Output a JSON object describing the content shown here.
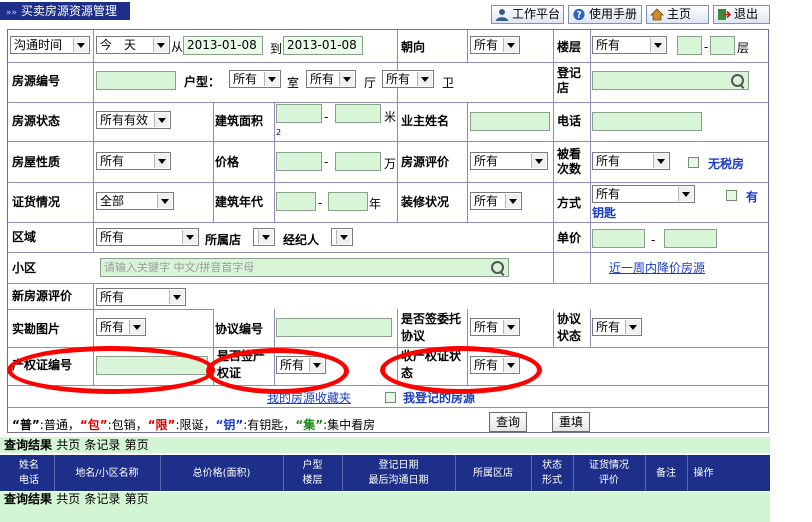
{
  "header": {
    "title": "买卖房源资源管理",
    "nav": {
      "workbench": "工作平台",
      "manual": "使用手册",
      "home": "主页",
      "logout": "退出"
    }
  },
  "form": {
    "row1": {
      "time_type": "沟通时间",
      "today": "今　天",
      "from_label": "从",
      "date_from": "2013-01-08",
      "to_label": "到",
      "date_to": "2013-01-08",
      "orientation_label": "朝向",
      "orientation_value": "所有",
      "floor_label": "楼层",
      "floor_value": "所有",
      "floor_sep": "-",
      "floor_unit": "层"
    },
    "row2": {
      "code_label": "房源编号",
      "layout_label": "户型：",
      "room_value": "所有",
      "room_unit": "室",
      "hall_value": "所有",
      "hall_unit": "厅",
      "bath_value": "所有",
      "bath_unit": "卫",
      "reg_store_label": "登记店"
    },
    "row3": {
      "status_label": "房源状态",
      "status_value": "所有有效",
      "area_label": "建筑面积",
      "area_sep": "-",
      "area_unit": "米",
      "area_sup": "2",
      "owner_label": "业主姓名",
      "phone_label": "电话"
    },
    "row4": {
      "nature_label": "房屋性质",
      "nature_value": "所有",
      "price_label": "价格",
      "price_sep": "-",
      "price_unit": "万",
      "eval_label": "房源评价",
      "eval_value": "所有",
      "viewed_label": "被看次数",
      "viewed_value": "所有",
      "no_tax": "无税房"
    },
    "row5": {
      "cert_label": "证货情况",
      "cert_value": "全部",
      "year_label": "建筑年代",
      "year_sep": "-",
      "year_unit": "年",
      "decor_label": "装修状况",
      "decor_value": "所有",
      "method_label": "方式",
      "method_value": "所有",
      "has_key_1": "有",
      "has_key_2": "钥匙"
    },
    "row6": {
      "district_label": "区域",
      "district_value": "所有",
      "store_label": "所属店",
      "agent_label": "经纪人",
      "unit_price_label": "单价",
      "unit_price_sep": "-"
    },
    "row7": {
      "community_label": "小区",
      "community_placeholder": "请输入关键字 中文/拼音首字母",
      "price_drop_link": "近一周内降价房源"
    },
    "row8": {
      "new_eval_label": "新房源评价",
      "new_eval_value": "所有"
    },
    "row9": {
      "photo_label": "实勘图片",
      "photo_value": "所有",
      "agreement_no_label": "协议编号",
      "signed_label_1": "是否签委托",
      "signed_label_2": "协议",
      "signed_value": "所有",
      "agreement_status_label_1": "协议",
      "agreement_status_label_2": "状态",
      "agreement_status_value": "所有"
    },
    "row10": {
      "prop_cert_no_label": "产权证编号",
      "has_cert_label_1": "是否签产",
      "has_cert_label_2": "权证",
      "has_cert_value": "所有",
      "receive_cert_label_1": "收产权证状",
      "receive_cert_label_2": "态",
      "receive_cert_value": "所有"
    },
    "row11": {
      "favorites_link": "我的房源收藏夹",
      "my_reg": "我登记的房源"
    },
    "legend": {
      "p1": "“普”",
      "p1t": ":普通，",
      "p2": "“包”",
      "p2t": ":包销，",
      "p3": "“限”",
      "p3t": ":限诞，",
      "p4": "“钥”",
      "p4t": ":有钥匙，",
      "p5": "“集”",
      "p5t": ":集中看房"
    },
    "buttons": {
      "query": "查询",
      "reset": "重填"
    }
  },
  "results": {
    "title": "查询结果",
    "pages": "共页",
    "records": "条记录",
    "page": "第页",
    "columns": [
      {
        "l1": "姓名",
        "l2": "电话"
      },
      {
        "l1": "地名/小区名称",
        "l2": ""
      },
      {
        "l1": "总价格(面积)",
        "l2": ""
      },
      {
        "l1": "户型",
        "l2": "楼层"
      },
      {
        "l1": "登记日期",
        "l2": "最后沟通日期"
      },
      {
        "l1": "所属区店",
        "l2": ""
      },
      {
        "l1": "状态",
        "l2": "形式"
      },
      {
        "l1": "证货情况",
        "l2": "评价"
      },
      {
        "l1": "备注",
        "l2": ""
      },
      {
        "l1": "操作",
        "l2": ""
      }
    ]
  },
  "colors": {
    "header_bg": "#1e2f8a",
    "input_bg": "#d8f5d8",
    "results_bg": "#d3f5d3",
    "annotation": "#ff0000",
    "link": "#1a3cc8"
  }
}
